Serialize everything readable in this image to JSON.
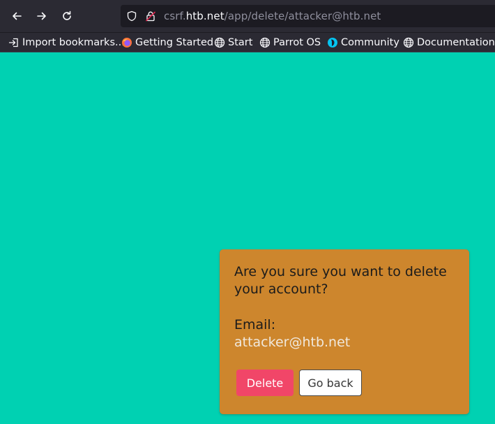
{
  "browser": {
    "url": {
      "scheme_prefix": "csrf.",
      "host": "htb.net",
      "path": "/app/delete/attacker@htb.net"
    },
    "bookmarks": [
      {
        "label": "Import bookmarks...",
        "icon": "import-icon"
      },
      {
        "label": "Getting Started",
        "icon": "firefox-icon"
      },
      {
        "label": "Start",
        "icon": "globe-icon"
      },
      {
        "label": "Parrot OS",
        "icon": "globe-icon"
      },
      {
        "label": "Community",
        "icon": "parrot-icon"
      },
      {
        "label": "Documentation",
        "icon": "globe-icon"
      }
    ]
  },
  "dialog": {
    "question": "Are you sure you want to delete your account?",
    "email_label": "Email:",
    "email_value": "attacker@htb.net",
    "delete_label": "Delete",
    "back_label": "Go back"
  },
  "colors": {
    "page_background": "#00d1b2",
    "card_background": "#cd862d",
    "delete_button": "#f14668",
    "chrome_background": "#2b2a33"
  }
}
